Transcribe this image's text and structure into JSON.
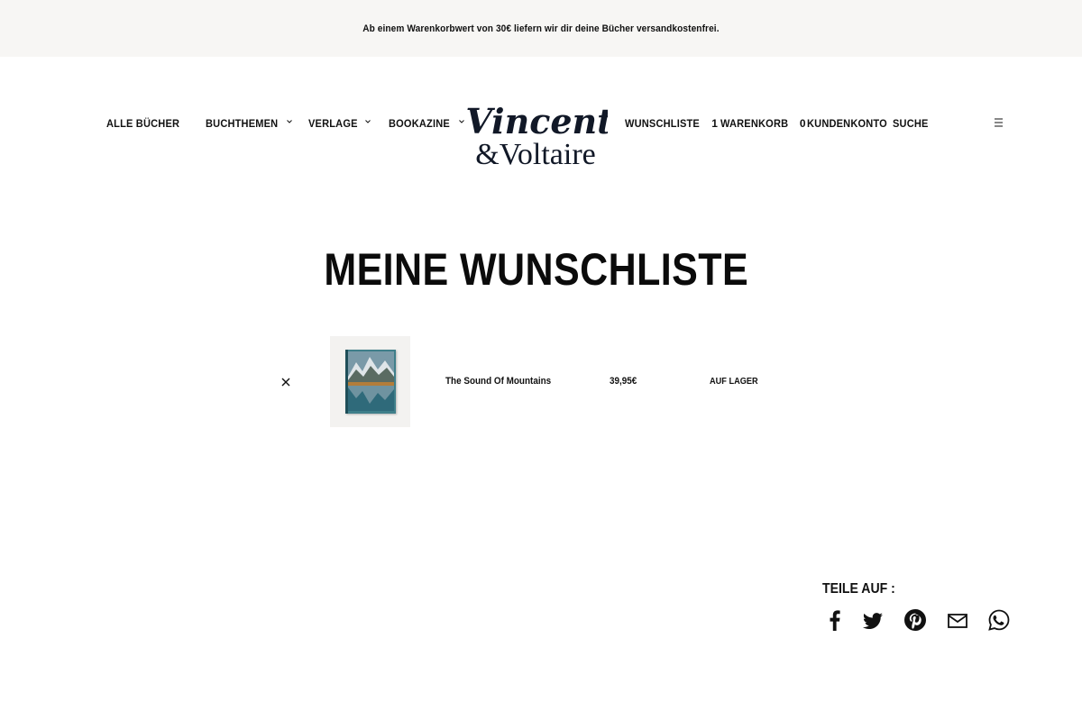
{
  "promo": {
    "text": "Ab einem Warenkorbwert von 30€ liefern wir dir deine Bücher versandkostenfrei."
  },
  "nav": {
    "all_books": "ALLE BÜCHER",
    "topics": "BUCHTHEMEN",
    "publishers": "VERLAGE",
    "bookazine": "BOOKAZINE",
    "wishlist": "WUNSCHLISTE",
    "wishlist_count": "1",
    "cart": "WARENKORB",
    "cart_count": "0",
    "account": "KUNDENKONTO",
    "search": "SUCHE"
  },
  "logo": {
    "line1": "Vincent",
    "line2": "&Voltaire",
    "color": "#111827"
  },
  "page": {
    "title": "MEINE WUNSCHLISTE"
  },
  "wishlist_items": [
    {
      "name": "The Sound Of Mountains",
      "price": "39,95€",
      "stock": "AUF LAGER"
    }
  ],
  "share": {
    "title": "TEILE AUF :",
    "icons": [
      "facebook-icon",
      "twitter-icon",
      "pinterest-icon",
      "email-icon",
      "whatsapp-icon"
    ]
  },
  "colors": {
    "promo_background": "#f7f6f4",
    "text": "#111111",
    "thumb_background": "#f3f2f0"
  }
}
